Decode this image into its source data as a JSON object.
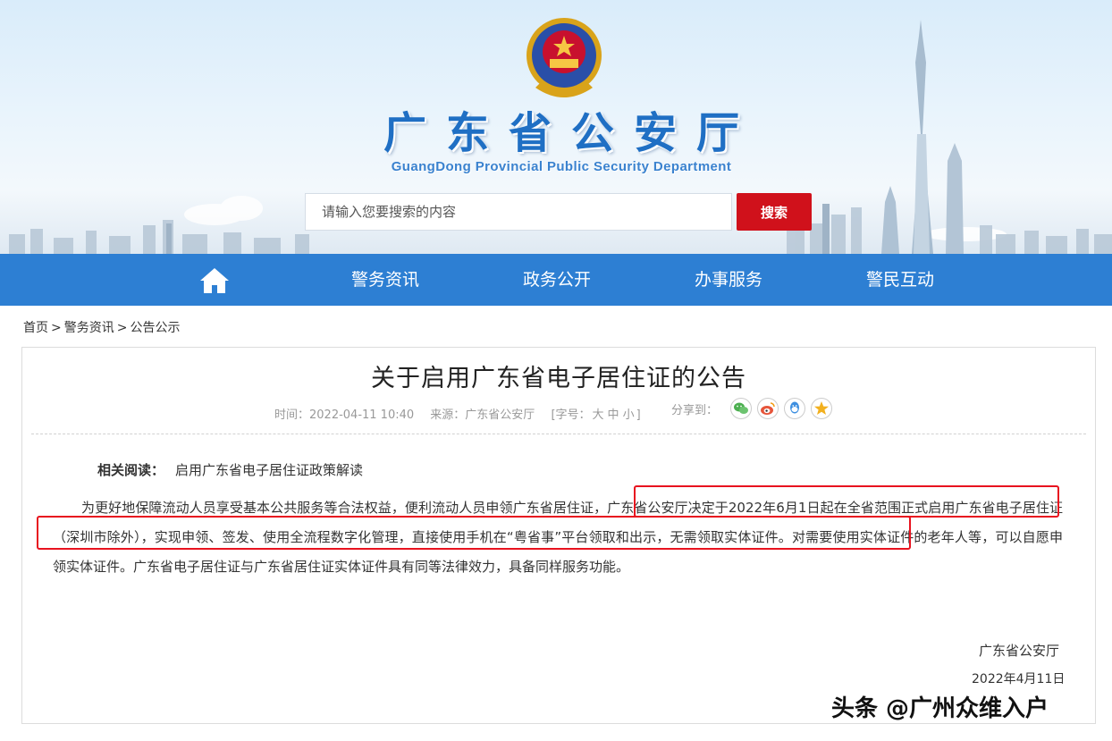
{
  "header": {
    "site_title": "广东省公安厅",
    "site_subtitle": "GuangDong Provincial Public Security Department",
    "emblem": "police-emblem",
    "search": {
      "placeholder": "请输入您要搜索的内容",
      "button_label": "搜索"
    }
  },
  "nav": {
    "home_icon": "home-icon",
    "items": [
      {
        "label": "警务资讯"
      },
      {
        "label": "政务公开"
      },
      {
        "label": "办事服务"
      },
      {
        "label": "警民互动"
      }
    ]
  },
  "breadcrumb": {
    "items": [
      "首页",
      "警务资讯",
      "公告公示"
    ],
    "separator": ">"
  },
  "article": {
    "title": "关于启用广东省电子居住证的公告",
    "meta": {
      "time": "时间：2022-04-11 10:40",
      "source": "来源：广东省公安厅",
      "font_size_prefix": "[字号：",
      "font_sizes": [
        "大",
        "中",
        "小"
      ],
      "font_size_suffix": "]",
      "share_label": "分享到：",
      "share_icons": [
        "wechat-icon",
        "weibo-icon",
        "qq-icon",
        "qzone-icon"
      ]
    },
    "related_label": "相关阅读：",
    "related_link": "启用广东省电子居住证政策解读",
    "paragraph": "为更好地保障流动人员享受基本公共服务等合法权益，便利流动人员申领广东省居住证，广东省公安厅决定于2022年6月1日起在全省范围正式启用广东省电子居住证（深圳市除外），实现申领、签发、使用全流程数字化管理，直接使用手机在“粤省事”平台领取和出示，无需领取实体证件。对需要使用实体证件的老年人等，可以自愿申领实体证件。广东省电子居住证与广东省居住证实体证件具有同等法律效力，具备同样服务功能。",
    "signature_org": "广东省公安厅",
    "signature_date": "2022年4月11日"
  },
  "watermark": "头条 @广州众维入户",
  "colors": {
    "nav_bg": "#2d7fd3",
    "search_button": "#d0111b",
    "title_blue": "#1f6fc4",
    "highlight_red": "#e8131f"
  }
}
